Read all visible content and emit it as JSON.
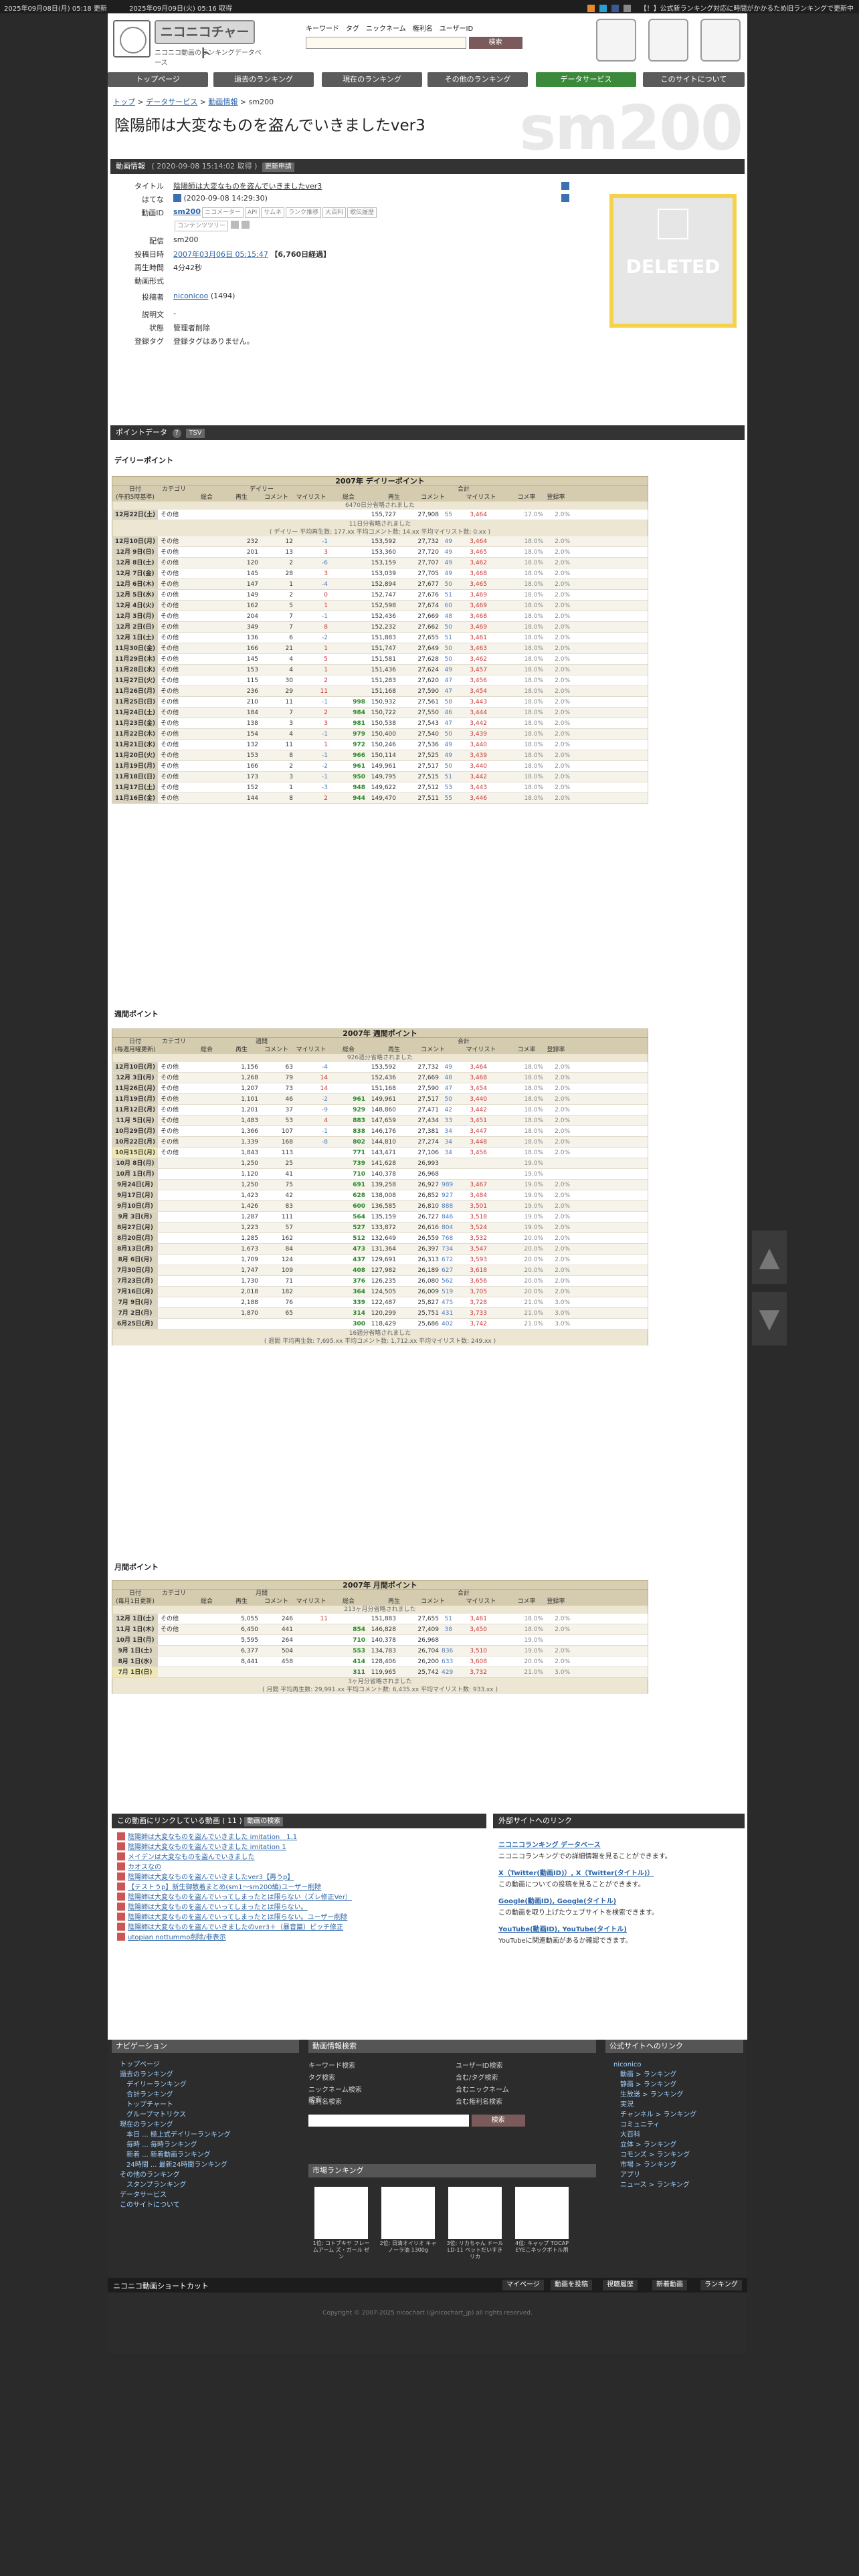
{
  "topbar": {
    "updated": "2025年09月08日(月) 05:18 更新",
    "fetched": "2025年09月09日(火) 05:16 取得",
    "notice": "【！】公式新ランキング対応に時間がかかるため旧ランキングで更新中"
  },
  "logo": {
    "name": "ニコニコチャート",
    "subtitle": "ニコニコ動画のランキングデータベース"
  },
  "search": {
    "tabs": [
      "キーワード",
      "タグ",
      "ニックネーム",
      "権利名",
      "ユーザーID"
    ],
    "button": "検索"
  },
  "nav": [
    "トップページ",
    "過去のランキング",
    "現在のランキング",
    "その他のランキング",
    "データサービス",
    "このサイトについて"
  ],
  "breadcrumb": [
    "トップ",
    "データサービス",
    "動画情報",
    "sm200"
  ],
  "page": {
    "id": "sm200",
    "title": "陰陽師は大変なものを盗んでいきましたver3"
  },
  "video_info": {
    "bar_title": "動画情報",
    "bar_date": "( 2020-09-08 15:14:02 取得 )",
    "bar_update": "更新申請",
    "title_label": "タイトル",
    "title_value": "陰陽師は大変なものを盗んでいきましたver3",
    "hatena_label": "はてな",
    "hatena_value": "(2020-09-08 14:29:30)",
    "id_label": "動画ID",
    "id_value": "sm200",
    "id_links": [
      "ニコメーター",
      "API",
      "サムネ",
      "ランク推移",
      "大百科",
      "歌伝履歴"
    ],
    "id_links2": [
      "コンテンツツリー"
    ],
    "deliver_label": "配信",
    "deliver_value": "sm200",
    "post_label": "投稿日時",
    "post_value": "2007年03月06日 05:15:47",
    "post_extra": "【6,760日経過】",
    "length_label": "再生時間",
    "length_value": "4分42秒",
    "format_label": "動画形式",
    "poster_label": "投稿者",
    "poster_name": "niconicoo",
    "poster_count": "(1494)",
    "desc_label": "説明文",
    "desc_value": "-",
    "state_label": "状態",
    "state_value": "管理者削除",
    "tag_label": "登録タグ",
    "tag_value": "登録タグはありません。",
    "thumb_text": "DELETED"
  },
  "points_bar": {
    "title": "ポイントデータ",
    "tsv": "TSV"
  },
  "daily": {
    "section": "デイリーポイント",
    "title": "2007年 デイリーポイント",
    "groups": [
      "日付\n(午前5時基準)",
      "カテゴリ",
      "デイリー",
      "合計"
    ],
    "cols": [
      "総合",
      "再生",
      "コメント",
      "マイリスト",
      "総合",
      "再生",
      "コメント",
      "マイリスト",
      "コメ率",
      "登録率"
    ],
    "note_top": "6470日分省略されました",
    "note_mid": "11日分省略されました",
    "note_avg": "( デイリー 平均再生数: 177.xx 平均コメント数: 14.xx 平均マイリスト数: 0.xx )",
    "first": [
      "12月22日(土)",
      "その他",
      "",
      "",
      "",
      "",
      "",
      "155,727",
      "27,908",
      "55",
      "3,464",
      "17.0%",
      "2.0%"
    ],
    "rows": [
      [
        "12月10日(月)",
        "その他",
        "",
        "232",
        "12",
        "-1",
        "",
        "153,592",
        "27,732",
        "49",
        "3,464",
        "18.0%",
        "2.0%"
      ],
      [
        "12月 9日(日)",
        "その他",
        "",
        "201",
        "13",
        "3",
        "",
        "153,360",
        "27,720",
        "49",
        "3,465",
        "18.0%",
        "2.0%"
      ],
      [
        "12月 8日(土)",
        "その他",
        "",
        "120",
        "2",
        "-6",
        "",
        "153,159",
        "27,707",
        "49",
        "3,462",
        "18.0%",
        "2.0%"
      ],
      [
        "12月 7日(金)",
        "その他",
        "",
        "145",
        "28",
        "3",
        "",
        "153,039",
        "27,705",
        "49",
        "3,468",
        "18.0%",
        "2.0%"
      ],
      [
        "12月 6日(木)",
        "その他",
        "",
        "147",
        "1",
        "-4",
        "",
        "152,894",
        "27,677",
        "50",
        "3,465",
        "18.0%",
        "2.0%"
      ],
      [
        "12月 5日(水)",
        "その他",
        "",
        "149",
        "2",
        "0",
        "",
        "152,747",
        "27,676",
        "51",
        "3,469",
        "18.0%",
        "2.0%"
      ],
      [
        "12月 4日(火)",
        "その他",
        "",
        "162",
        "5",
        "1",
        "",
        "152,598",
        "27,674",
        "60",
        "3,469",
        "18.0%",
        "2.0%"
      ],
      [
        "12月 3日(月)",
        "その他",
        "",
        "204",
        "7",
        "-1",
        "",
        "152,436",
        "27,669",
        "48",
        "3,468",
        "18.0%",
        "2.0%"
      ],
      [
        "12月 2日(日)",
        "その他",
        "",
        "349",
        "7",
        "8",
        "",
        "152,232",
        "27,662",
        "50",
        "3,469",
        "18.0%",
        "2.0%"
      ],
      [
        "12月 1日(土)",
        "その他",
        "",
        "136",
        "6",
        "-2",
        "",
        "151,883",
        "27,655",
        "51",
        "3,461",
        "18.0%",
        "2.0%"
      ],
      [
        "11月30日(金)",
        "その他",
        "",
        "166",
        "21",
        "1",
        "",
        "151,747",
        "27,649",
        "50",
        "3,463",
        "18.0%",
        "2.0%"
      ],
      [
        "11月29日(木)",
        "その他",
        "",
        "145",
        "4",
        "5",
        "",
        "151,581",
        "27,628",
        "50",
        "3,462",
        "18.0%",
        "2.0%"
      ],
      [
        "11月28日(水)",
        "その他",
        "",
        "153",
        "4",
        "1",
        "",
        "151,436",
        "27,624",
        "49",
        "3,457",
        "18.0%",
        "2.0%"
      ],
      [
        "11月27日(火)",
        "その他",
        "",
        "115",
        "30",
        "2",
        "",
        "151,283",
        "27,620",
        "47",
        "3,456",
        "18.0%",
        "2.0%"
      ],
      [
        "11月26日(月)",
        "その他",
        "",
        "236",
        "29",
        "11",
        "",
        "151,168",
        "27,590",
        "47",
        "3,454",
        "18.0%",
        "2.0%"
      ],
      [
        "11月25日(日)",
        "その他",
        "",
        "210",
        "11",
        "-1",
        "998",
        "150,932",
        "27,561",
        "58",
        "3,443",
        "18.0%",
        "2.0%"
      ],
      [
        "11月24日(土)",
        "その他",
        "",
        "184",
        "7",
        "2",
        "984",
        "150,722",
        "27,550",
        "46",
        "3,444",
        "18.0%",
        "2.0%"
      ],
      [
        "11月23日(金)",
        "その他",
        "",
        "138",
        "3",
        "3",
        "981",
        "150,538",
        "27,543",
        "47",
        "3,442",
        "18.0%",
        "2.0%"
      ],
      [
        "11月22日(木)",
        "その他",
        "",
        "154",
        "4",
        "-1",
        "979",
        "150,400",
        "27,540",
        "50",
        "3,439",
        "18.0%",
        "2.0%"
      ],
      [
        "11月21日(水)",
        "その他",
        "",
        "132",
        "11",
        "1",
        "972",
        "150,246",
        "27,536",
        "49",
        "3,440",
        "18.0%",
        "2.0%"
      ],
      [
        "11月20日(火)",
        "その他",
        "",
        "153",
        "8",
        "-1",
        "966",
        "150,114",
        "27,525",
        "49",
        "3,439",
        "18.0%",
        "2.0%"
      ],
      [
        "11月19日(月)",
        "その他",
        "",
        "166",
        "2",
        "-2",
        "961",
        "149,961",
        "27,517",
        "50",
        "3,440",
        "18.0%",
        "2.0%"
      ],
      [
        "11月18日(日)",
        "その他",
        "",
        "173",
        "3",
        "-1",
        "950",
        "149,795",
        "27,515",
        "51",
        "3,442",
        "18.0%",
        "2.0%"
      ],
      [
        "11月17日(土)",
        "その他",
        "",
        "152",
        "1",
        "-3",
        "948",
        "149,622",
        "27,512",
        "53",
        "3,443",
        "18.0%",
        "2.0%"
      ],
      [
        "11月16日(金)",
        "その他",
        "",
        "144",
        "8",
        "2",
        "944",
        "149,470",
        "27,511",
        "55",
        "3,446",
        "18.0%",
        "2.0%"
      ]
    ]
  },
  "weekly": {
    "section": "週間ポイント",
    "title": "2007年 週間ポイント",
    "groups": [
      "日付\n(毎週月曜更新)",
      "カテゴリ",
      "週間",
      "合計"
    ],
    "cols": [
      "総合",
      "再生",
      "コメント",
      "マイリスト",
      "総合",
      "再生",
      "コメント",
      "マイリスト",
      "コメ率",
      "登録率"
    ],
    "note_top": "926週分省略されました",
    "note_bottom": "16週分省略されました",
    "note_avg": "( 週間 平均再生数: 7,695.xx 平均コメント数: 1,712.xx 平均マイリスト数: 249.xx )",
    "rows": [
      [
        "12月10日(月)",
        "その他",
        "",
        "1,156",
        "63",
        "-4",
        "",
        "153,592",
        "27,732",
        "49",
        "3,464",
        "18.0%",
        "2.0%"
      ],
      [
        "12月 3日(月)",
        "その他",
        "",
        "1,268",
        "79",
        "14",
        "",
        "152,436",
        "27,669",
        "48",
        "3,468",
        "18.0%",
        "2.0%"
      ],
      [
        "11月26日(月)",
        "その他",
        "",
        "1,207",
        "73",
        "14",
        "",
        "151,168",
        "27,590",
        "47",
        "3,454",
        "18.0%",
        "2.0%"
      ],
      [
        "11月19日(月)",
        "その他",
        "",
        "1,101",
        "46",
        "-2",
        "961",
        "149,961",
        "27,517",
        "50",
        "3,440",
        "18.0%",
        "2.0%"
      ],
      [
        "11月12日(月)",
        "その他",
        "",
        "1,201",
        "37",
        "-9",
        "929",
        "148,860",
        "27,471",
        "42",
        "3,442",
        "18.0%",
        "2.0%"
      ],
      [
        "11月 5日(月)",
        "その他",
        "",
        "1,483",
        "53",
        "4",
        "883",
        "147,659",
        "27,434",
        "33",
        "3,451",
        "18.0%",
        "2.0%"
      ],
      [
        "10月29日(月)",
        "その他",
        "",
        "1,366",
        "107",
        "-1",
        "838",
        "146,176",
        "27,381",
        "34",
        "3,447",
        "18.0%",
        "2.0%"
      ],
      [
        "10月22日(月)",
        "その他",
        "",
        "1,339",
        "168",
        "-8",
        "802",
        "144,810",
        "27,274",
        "34",
        "3,448",
        "18.0%",
        "2.0%"
      ],
      [
        "10月15日(月)",
        "その他",
        "",
        "1,843",
        "113",
        "",
        "771",
        "143,471",
        "27,106",
        "34",
        "3,456",
        "18.0%",
        "2.0%"
      ],
      [
        "10月 8日(月)",
        "",
        "",
        "1,250",
        "25",
        "",
        "739",
        "141,628",
        "26,993",
        "",
        "",
        "19.0%",
        ""
      ],
      [
        "10月 1日(月)",
        "",
        "",
        "1,120",
        "41",
        "",
        "710",
        "140,378",
        "26,968",
        "",
        "",
        "19.0%",
        ""
      ],
      [
        "9月24日(月)",
        "",
        "",
        "1,250",
        "75",
        "",
        "691",
        "139,258",
        "26,927",
        "989",
        "3,467",
        "19.0%",
        "2.0%"
      ],
      [
        "9月17日(月)",
        "",
        "",
        "1,423",
        "42",
        "",
        "628",
        "138,008",
        "26,852",
        "927",
        "3,484",
        "19.0%",
        "2.0%"
      ],
      [
        "9月10日(月)",
        "",
        "",
        "1,426",
        "83",
        "",
        "600",
        "136,585",
        "26,810",
        "888",
        "3,501",
        "19.0%",
        "2.0%"
      ],
      [
        "9月 3日(月)",
        "",
        "",
        "1,287",
        "111",
        "",
        "564",
        "135,159",
        "26,727",
        "846",
        "3,518",
        "19.0%",
        "2.0%"
      ],
      [
        "8月27日(月)",
        "",
        "",
        "1,223",
        "57",
        "",
        "527",
        "133,872",
        "26,616",
        "804",
        "3,524",
        "19.0%",
        "2.0%"
      ],
      [
        "8月20日(月)",
        "",
        "",
        "1,285",
        "162",
        "",
        "512",
        "132,649",
        "26,559",
        "768",
        "3,532",
        "20.0%",
        "2.0%"
      ],
      [
        "8月13日(月)",
        "",
        "",
        "1,673",
        "84",
        "",
        "473",
        "131,364",
        "26,397",
        "734",
        "3,547",
        "20.0%",
        "2.0%"
      ],
      [
        "8月 6日(月)",
        "",
        "",
        "1,709",
        "124",
        "",
        "437",
        "129,691",
        "26,313",
        "672",
        "3,593",
        "20.0%",
        "2.0%"
      ],
      [
        "7月30日(月)",
        "",
        "",
        "1,747",
        "109",
        "",
        "408",
        "127,982",
        "26,189",
        "627",
        "3,618",
        "20.0%",
        "2.0%"
      ],
      [
        "7月23日(月)",
        "",
        "",
        "1,730",
        "71",
        "",
        "376",
        "126,235",
        "26,080",
        "562",
        "3,656",
        "20.0%",
        "2.0%"
      ],
      [
        "7月16日(月)",
        "",
        "",
        "2,018",
        "182",
        "",
        "364",
        "124,505",
        "26,009",
        "519",
        "3,705",
        "20.0%",
        "2.0%"
      ],
      [
        "7月 9日(月)",
        "",
        "",
        "2,188",
        "76",
        "",
        "339",
        "122,487",
        "25,827",
        "475",
        "3,728",
        "21.0%",
        "3.0%"
      ],
      [
        "7月 2日(月)",
        "",
        "",
        "1,870",
        "65",
        "",
        "314",
        "120,299",
        "25,751",
        "431",
        "3,733",
        "21.0%",
        "3.0%"
      ],
      [
        "6月25日(月)",
        "",
        "",
        "",
        "",
        "",
        "300",
        "118,429",
        "25,686",
        "402",
        "3,742",
        "21.0%",
        "3.0%"
      ]
    ]
  },
  "monthly": {
    "section": "月間ポイント",
    "title": "2007年 月間ポイント",
    "groups": [
      "日付\n(毎月1日更新)",
      "カテゴリ",
      "月間",
      "合計"
    ],
    "cols": [
      "総合",
      "再生",
      "コメント",
      "マイリスト",
      "総合",
      "再生",
      "コメント",
      "マイリスト",
      "コメ率",
      "登録率"
    ],
    "note_top": "213ヶ月分省略されました",
    "note_bottom": "3ヶ月分省略されました",
    "note_avg": "( 月間 平均再生数: 29,991.xx 平均コメント数: 6,435.xx 平均マイリスト数: 933.xx )",
    "rows": [
      [
        "12月 1日(土)",
        "その他",
        "",
        "5,055",
        "246",
        "11",
        "",
        "151,883",
        "27,655",
        "51",
        "3,461",
        "18.0%",
        "2.0%"
      ],
      [
        "11月 1日(木)",
        "その他",
        "",
        "6,450",
        "441",
        "",
        "854",
        "146,828",
        "27,409",
        "38",
        "3,450",
        "18.0%",
        "2.0%"
      ],
      [
        "10月 1日(月)",
        "",
        "",
        "5,595",
        "264",
        "",
        "710",
        "140,378",
        "26,968",
        "",
        "",
        "19.0%",
        ""
      ],
      [
        "9月 1日(土)",
        "",
        "",
        "6,377",
        "504",
        "",
        "553",
        "134,783",
        "26,704",
        "836",
        "3,510",
        "19.0%",
        "2.0%"
      ],
      [
        "8月 1日(水)",
        "",
        "",
        "8,441",
        "458",
        "",
        "414",
        "128,406",
        "26,200",
        "633",
        "3,608",
        "20.0%",
        "2.0%"
      ],
      [
        "7月 1日(日)",
        "",
        "",
        "",
        "",
        "",
        "311",
        "119,965",
        "25,742",
        "429",
        "3,732",
        "21.0%",
        "3.0%"
      ]
    ]
  },
  "links": {
    "bar": "この動画にリンクしている動画",
    "count": "( 11 )",
    "btn": "動画の検索",
    "items": [
      "陰陽師は大変なものを盗んでいきました imitation　1.1",
      "陰陽師は大変なものを盗んでいきました imitation 1",
      "メイデンは大変なものを盗んでいきました",
      "カオスなの",
      "陰陽師は大変なものを盗んでいきましたver3【再うp】",
      "【テストうp】新生御散着まとめ(sm1～sm200編)ユーザー削除",
      "陰陽師は大変なものを盗んでいってしまったとは限らない（ズレ修正Ver）",
      "陰陽師は大変なものを盗んでいってしまったとは限らない。",
      "陰陽師は大変なものを盗んでいってしまったとは限らない。ユーザー削除",
      "陰陽師は大変なものを盗んでいきましたのver3＋（暴音篇）ピッチ修正",
      "utopian nottummo削除/非表示"
    ]
  },
  "external": {
    "bar": "外部サイトへのリンク",
    "items": [
      {
        "title": "ニコニコランキング データベース",
        "desc": "ニコニコランキングでの詳細情報を見ることができます。"
      },
      {
        "title": "X（Twitter(動画ID)）, X（Twitter(タイトル)）",
        "desc": "この動画についての投稿を見ることができます。"
      },
      {
        "title": "Google(動画ID), Google(タイトル)",
        "desc": "この動画を取り上げたウェブサイトを検索できます。"
      },
      {
        "title": "YouTube(動画ID), YouTube(タイトル)",
        "desc": "YouTubeに関連動画があるか確認できます。"
      }
    ]
  },
  "footer": {
    "nav_title": "ナビゲーション",
    "nav_items": [
      "トップページ",
      "過去のランキング",
      "　デイリーランキング",
      "　合計ランキング",
      "　トップチャート",
      "　グループマトリクス",
      "現在のランキング",
      "　本日 ... 極上式デイリーランキング",
      "　毎時 ... 毎時ランキング",
      "　新着 ... 新着動画ランキング",
      "　24時間 ... 最新24時間ランキング",
      "その他のランキング",
      "　スタンプランキング",
      "データサービス",
      "このサイトについて"
    ],
    "search_title": "動画情報検索",
    "search_items": [
      "キーワード検索",
      "ユーザーID検索",
      "タグ検索",
      "含む/タグ検索",
      "ニックネーム検索",
      "含むニックネーム検索",
      "権利名検索",
      "含む権利名検索"
    ],
    "search_btn": "検索",
    "market_title": "市場ランキング",
    "products": [
      "1位: コトブキヤ フレームアーム ズ・ガール ゼン",
      "2位: 日清オイリオ キャノーラ油 1300g",
      "3位: リカちゃん ドール LD-11 ペットだいすき リカ",
      "4位: キャップ TOCAP EYEこネックボトル用"
    ],
    "official_title": "公式サイトへのリンク",
    "official_items": [
      "niconico",
      "　動画 > ランキング",
      "　静画 > ランキング",
      "　生放送 > ランキング",
      "　実況",
      "　チャンネル > ランキング",
      "　コミュニティ",
      "　大百科",
      "　立体 > ランキング",
      "　コモンズ > ランキング",
      "　市場 > ランキング",
      "　アプリ",
      "　ニュース > ランキング"
    ],
    "shortcut_title": "ニコニコ動画ショートカット",
    "shortcut_btns": [
      "マイページ",
      "動画を投稿",
      "視聴履歴",
      "新着動画",
      "ランキング"
    ],
    "copyright": "Copyright © 2007-2025 nicochart (@nicochart_jp) all rights reserved."
  }
}
